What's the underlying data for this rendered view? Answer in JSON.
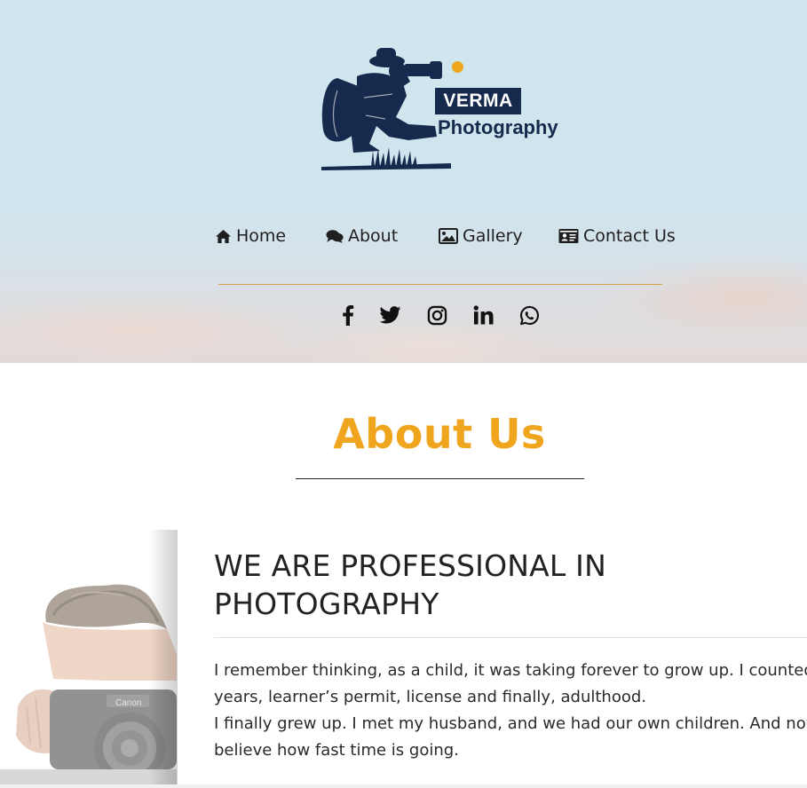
{
  "brand": {
    "name_line1": "VERMA",
    "name_line2": "Photography",
    "accent_color": "#f0a51e",
    "navy_color": "#162a4d"
  },
  "nav": {
    "items": [
      {
        "label": "Home",
        "icon": "home-icon"
      },
      {
        "label": "About",
        "icon": "comments-icon"
      },
      {
        "label": "Gallery",
        "icon": "image-icon"
      },
      {
        "label": "Contact Us",
        "icon": "id-card-icon"
      }
    ]
  },
  "social": [
    "facebook-icon",
    "twitter-icon",
    "instagram-icon",
    "linkedin-icon",
    "whatsapp-icon"
  ],
  "about": {
    "title": "About Us",
    "headline_line1": "WE ARE PROFESSIONAL IN",
    "headline_line2": "PHOTOGRAPHY",
    "paragraph_lines": [
      "I remember thinking, as a child, it was taking forever to grow up. I counted e",
      "years, learner’s permit, license and finally, adulthood.",
      "I finally grew up. I met my husband, and we had our own children. And now,",
      "believe how fast time is going."
    ]
  }
}
